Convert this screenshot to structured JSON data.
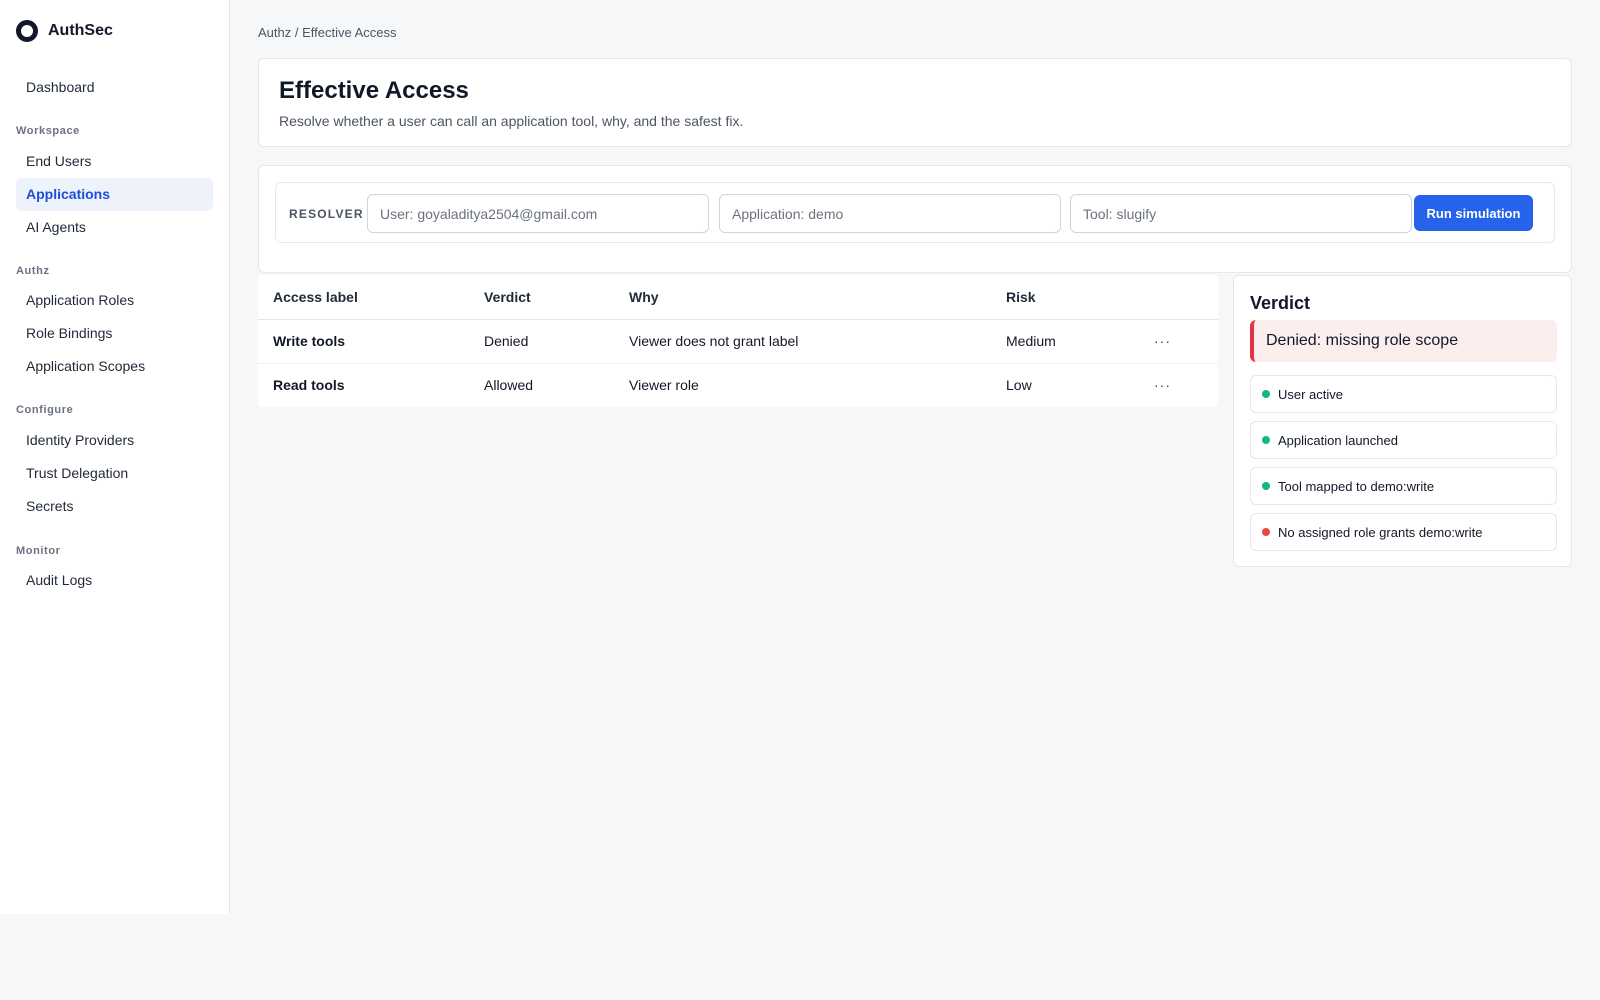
{
  "brand": {
    "name": "AuthSec"
  },
  "sidebar": {
    "dashboard": "Dashboard",
    "sections": [
      {
        "title": "Workspace",
        "items": [
          "End Users",
          "Applications",
          "AI Agents"
        ]
      },
      {
        "title": "Authz",
        "items": [
          "Application Roles",
          "Role Bindings",
          "Application Scopes"
        ]
      },
      {
        "title": "Configure",
        "items": [
          "Identity Providers",
          "Trust Delegation",
          "Secrets"
        ]
      },
      {
        "title": "Monitor",
        "items": [
          "Audit Logs"
        ]
      }
    ],
    "active_item": "Applications"
  },
  "breadcrumb": "Authz / Effective Access",
  "header": {
    "title": "Effective Access",
    "subtitle": "Resolve whether a user can call an application tool, why, and the safest fix."
  },
  "resolver": {
    "label": "RESOLVER",
    "user_placeholder": "User: goyaladitya2504@gmail.com",
    "application_placeholder": "Application: demo",
    "tool_placeholder": "Tool: slugify",
    "run_label": "Run simulation"
  },
  "table": {
    "columns": [
      "Access label",
      "Verdict",
      "Why",
      "Risk"
    ],
    "rows": [
      {
        "label": "Write tools",
        "verdict": "Denied",
        "why": "Viewer does not grant label",
        "risk": "Medium",
        "menu": "···"
      },
      {
        "label": "Read tools",
        "verdict": "Allowed",
        "why": "Viewer role",
        "risk": "Low",
        "menu": "···"
      }
    ]
  },
  "verdict": {
    "title": "Verdict",
    "banner": "Denied: missing role scope",
    "checks": [
      {
        "text": "User active",
        "status": "pass"
      },
      {
        "text": "Application launched",
        "status": "pass"
      },
      {
        "text": "Tool mapped to demo:write",
        "status": "pass"
      },
      {
        "text": "No assigned role grants demo:write",
        "status": "fail"
      }
    ]
  },
  "colors": {
    "accent": "#2563eb",
    "active_nav_bg": "#eef2fb",
    "pass": "#10b981",
    "fail": "#ef4444",
    "denied_banner_bg": "#fdeeee",
    "denied_banner_border": "#dc3545"
  }
}
